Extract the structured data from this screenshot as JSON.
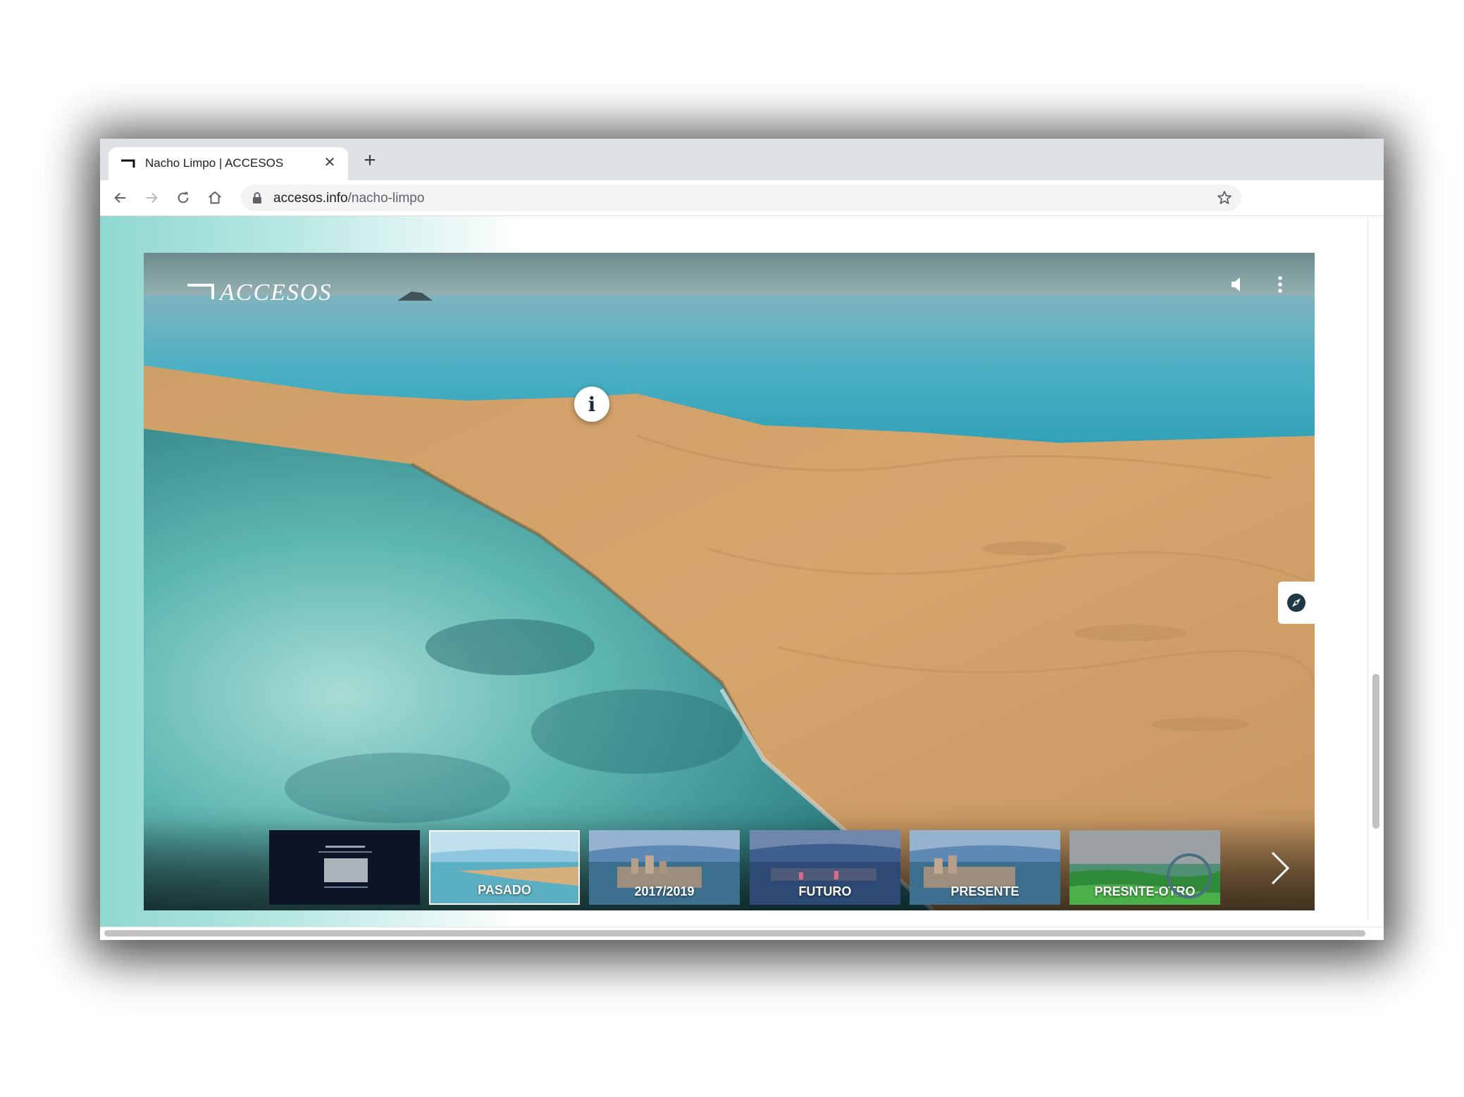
{
  "browser": {
    "tab": {
      "title": "Nacho Limpo | ACCESOS",
      "close": "✕"
    },
    "new_tab": "+",
    "address": {
      "host": "accesos.info",
      "path": "/nacho-limpo"
    },
    "icons": [
      "back-arrow-icon",
      "forward-arrow-icon",
      "reload-icon",
      "home-icon",
      "lock-icon",
      "star-icon"
    ]
  },
  "viewer": {
    "logo": "ACCESOS",
    "info_hotspot": "i",
    "icons": [
      "sound-icon",
      "more-vert-icon",
      "compass-icon",
      "next-chevron-icon"
    ],
    "scenes": [
      {
        "label": "",
        "style": "dark-text"
      },
      {
        "label": "PASADO",
        "style": "beach",
        "active": true
      },
      {
        "label": "2017/2019",
        "style": "city"
      },
      {
        "label": "FUTURO",
        "style": "night-city"
      },
      {
        "label": "PRESENTE",
        "style": "city"
      },
      {
        "label": "PRESNTE-OTRO",
        "style": "green"
      }
    ]
  },
  "colors": {
    "accent": "#49707f",
    "sand": "#d2a067",
    "sea": "#3fa7b3",
    "chrome": "#dee1e6"
  }
}
